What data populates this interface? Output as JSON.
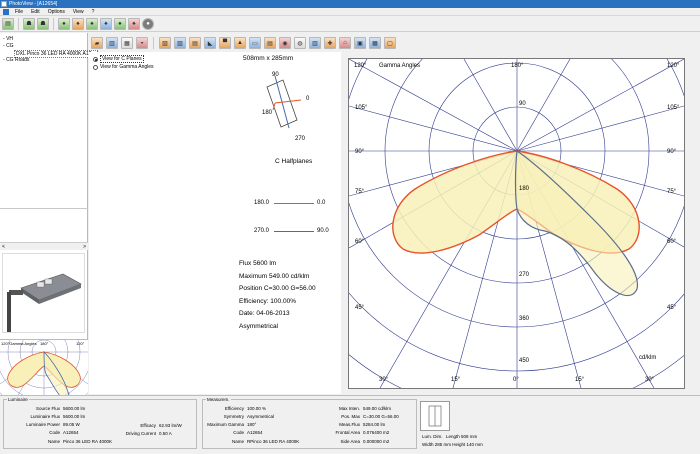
{
  "app": {
    "title": "PhotoView - [A12654]"
  },
  "menu": {
    "items": [
      "File",
      "Edit",
      "Options",
      "View",
      "?"
    ]
  },
  "tree": {
    "items": [
      "VH",
      "CG",
      "DXL Pinco 36 LED RA 4000K A12...",
      "CG Roads"
    ]
  },
  "left": {
    "scroll_left": "<",
    "scroll_right": ">"
  },
  "mini_chart": {
    "left_label": "120°Gamma Angles",
    "top_label": "180°",
    "right_label": "120°"
  },
  "view_options": {
    "cplanes_label": "View for C Planes",
    "gamma_label": "View for Gamma Angles",
    "selected": "cplanes"
  },
  "dimensions": {
    "text": "508mm x 285mm"
  },
  "orientation": {
    "top": "90",
    "right": "0",
    "left": "180",
    "bottom": "270",
    "caption": "C Halfplanes"
  },
  "halfplanes": [
    {
      "left": "180.0",
      "right": "0.0",
      "color": "#e8532a"
    },
    {
      "left": "270.0",
      "right": "90.0",
      "color": "#4a6aa8"
    }
  ],
  "info": {
    "flux": "Flux 5600  lm",
    "maximum": "Maximum 549.00  cd/klm",
    "position": "Position C=30.00 G=56.00",
    "efficiency": "Efficiency: 100.00%",
    "date": "Date: 04-06-2013",
    "symmetry": "Asymmetrical"
  },
  "polar": {
    "top_left": "120°",
    "title": "Gamma Angles",
    "top_center": "180°",
    "top_right": "120°",
    "left_angles": [
      "105°",
      "90°",
      "75°",
      "60°",
      "45°"
    ],
    "right_angles": [
      "105°",
      "90°",
      "75°",
      "60°",
      "45°"
    ],
    "bottom_angles": [
      "30°",
      "15°",
      "0°",
      "15°",
      "30°"
    ],
    "radial_labels": [
      "90",
      "180",
      "270",
      "360",
      "450"
    ],
    "unit": "cd/klm",
    "colors": {
      "c0": "#e8532a",
      "c90": "#4a6aa8",
      "fill": "#f8f0b8",
      "grid": "#2f3b8f"
    }
  },
  "bottom": {
    "luminaire_legend": "Luminaire",
    "source_flux_label": "Source Flux",
    "source_flux_value": "5600.00 lm",
    "lum_flux_label": "Luminaire Flux",
    "lum_flux_value": "5600.00 lm",
    "lum_power_label": "Luminaire Power",
    "lum_power_value": "89.05 W",
    "code_label": "Code",
    "code_value": "A12654",
    "name_label": "Name",
    "name_value": "Pinco 36 LED RA 4000K",
    "efficacy_label": "Efficacy",
    "efficacy_value": "62.93 lm/W",
    "drive_label": "Driving Current",
    "drive_value": "0.50 A",
    "measure_legend": "Measurem.",
    "m_eff_label": "Efficiency",
    "m_eff_value": "100.00 %",
    "m_sym_label": "Symmetry",
    "m_sym_value": "Asymmetrical",
    "m_maxg_label": "Maximum Gamma",
    "m_maxg_value": "180°",
    "m_code_label": "Code",
    "m_code_value": "A12654",
    "m_name_label": "Name",
    "m_name_value": "RPinco 36 LED RA 4000K",
    "max_int_label": "Max Inten.",
    "max_int_value": "549.00  cd/klm",
    "pos_max_label": "Pos. Max",
    "pos_max_value": "C=30.00 G=56.00",
    "meas_flux_label": "Meas.Flux",
    "meas_flux_value": "5284.00 lm",
    "frontal_label": "Frontal Area",
    "frontal_value": "0.076400 m2",
    "side_label": "Side Area",
    "side_value": "0.000000 m2",
    "lum_dim_label": "Lum. Dim.",
    "length_value": "Length 508 mm",
    "width_height_value": "Width 285 mm Height 140 mm"
  }
}
